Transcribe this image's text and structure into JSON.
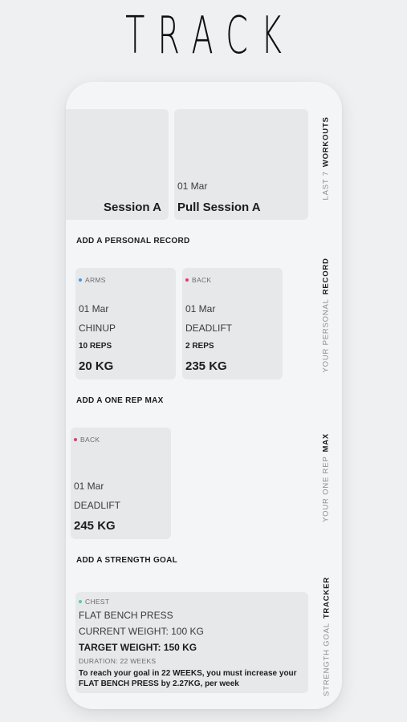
{
  "header": {
    "title": "TRACK"
  },
  "workouts": {
    "label_light": "LAST 7",
    "label_strong": "WORKOUTS",
    "sessions": [
      {
        "date": "",
        "name": "Session A"
      },
      {
        "date": "01 Mar",
        "name": "Pull Session A"
      }
    ]
  },
  "personal_record": {
    "add_label": "ADD A PERSONAL RECORD",
    "label_light": "YOUR PERSONAL",
    "label_strong": "RECORD",
    "cards": [
      {
        "category": "ARMS",
        "category_color": "#3d9be9",
        "date": "01 Mar",
        "exercise": "CHINUP",
        "reps": "10 REPS",
        "weight": "20 KG"
      },
      {
        "category": "BACK",
        "category_color": "#e8357a",
        "date": "01 Mar",
        "exercise": "DEADLIFT",
        "reps": "2 REPS",
        "weight": "235 KG"
      }
    ]
  },
  "one_rep_max": {
    "add_label": "ADD A ONE REP MAX",
    "label_light": "YOUR ONE REP",
    "label_strong": "MAX",
    "cards": [
      {
        "category": "BACK",
        "category_color": "#e8357a",
        "date": "01 Mar",
        "exercise": "DEADLIFT",
        "weight": "245 KG"
      }
    ]
  },
  "strength_goal": {
    "add_label": "ADD A STRENGTH GOAL",
    "label_light": "STRENGTH GOAL",
    "label_strong": "TRACKER",
    "card": {
      "category": "CHEST",
      "category_color": "#4fd1a5",
      "exercise": "FLAT BENCH PRESS",
      "current": "CURRENT WEIGHT: 100 KG",
      "target": "TARGET WEIGHT: 150 KG",
      "duration": "DURATION: 22 WEEKS",
      "advice_line1": "To reach your goal in 22 WEEKS, you must increase your",
      "advice_line2": "FLAT BENCH PRESS by 2.27KG, per week"
    }
  }
}
